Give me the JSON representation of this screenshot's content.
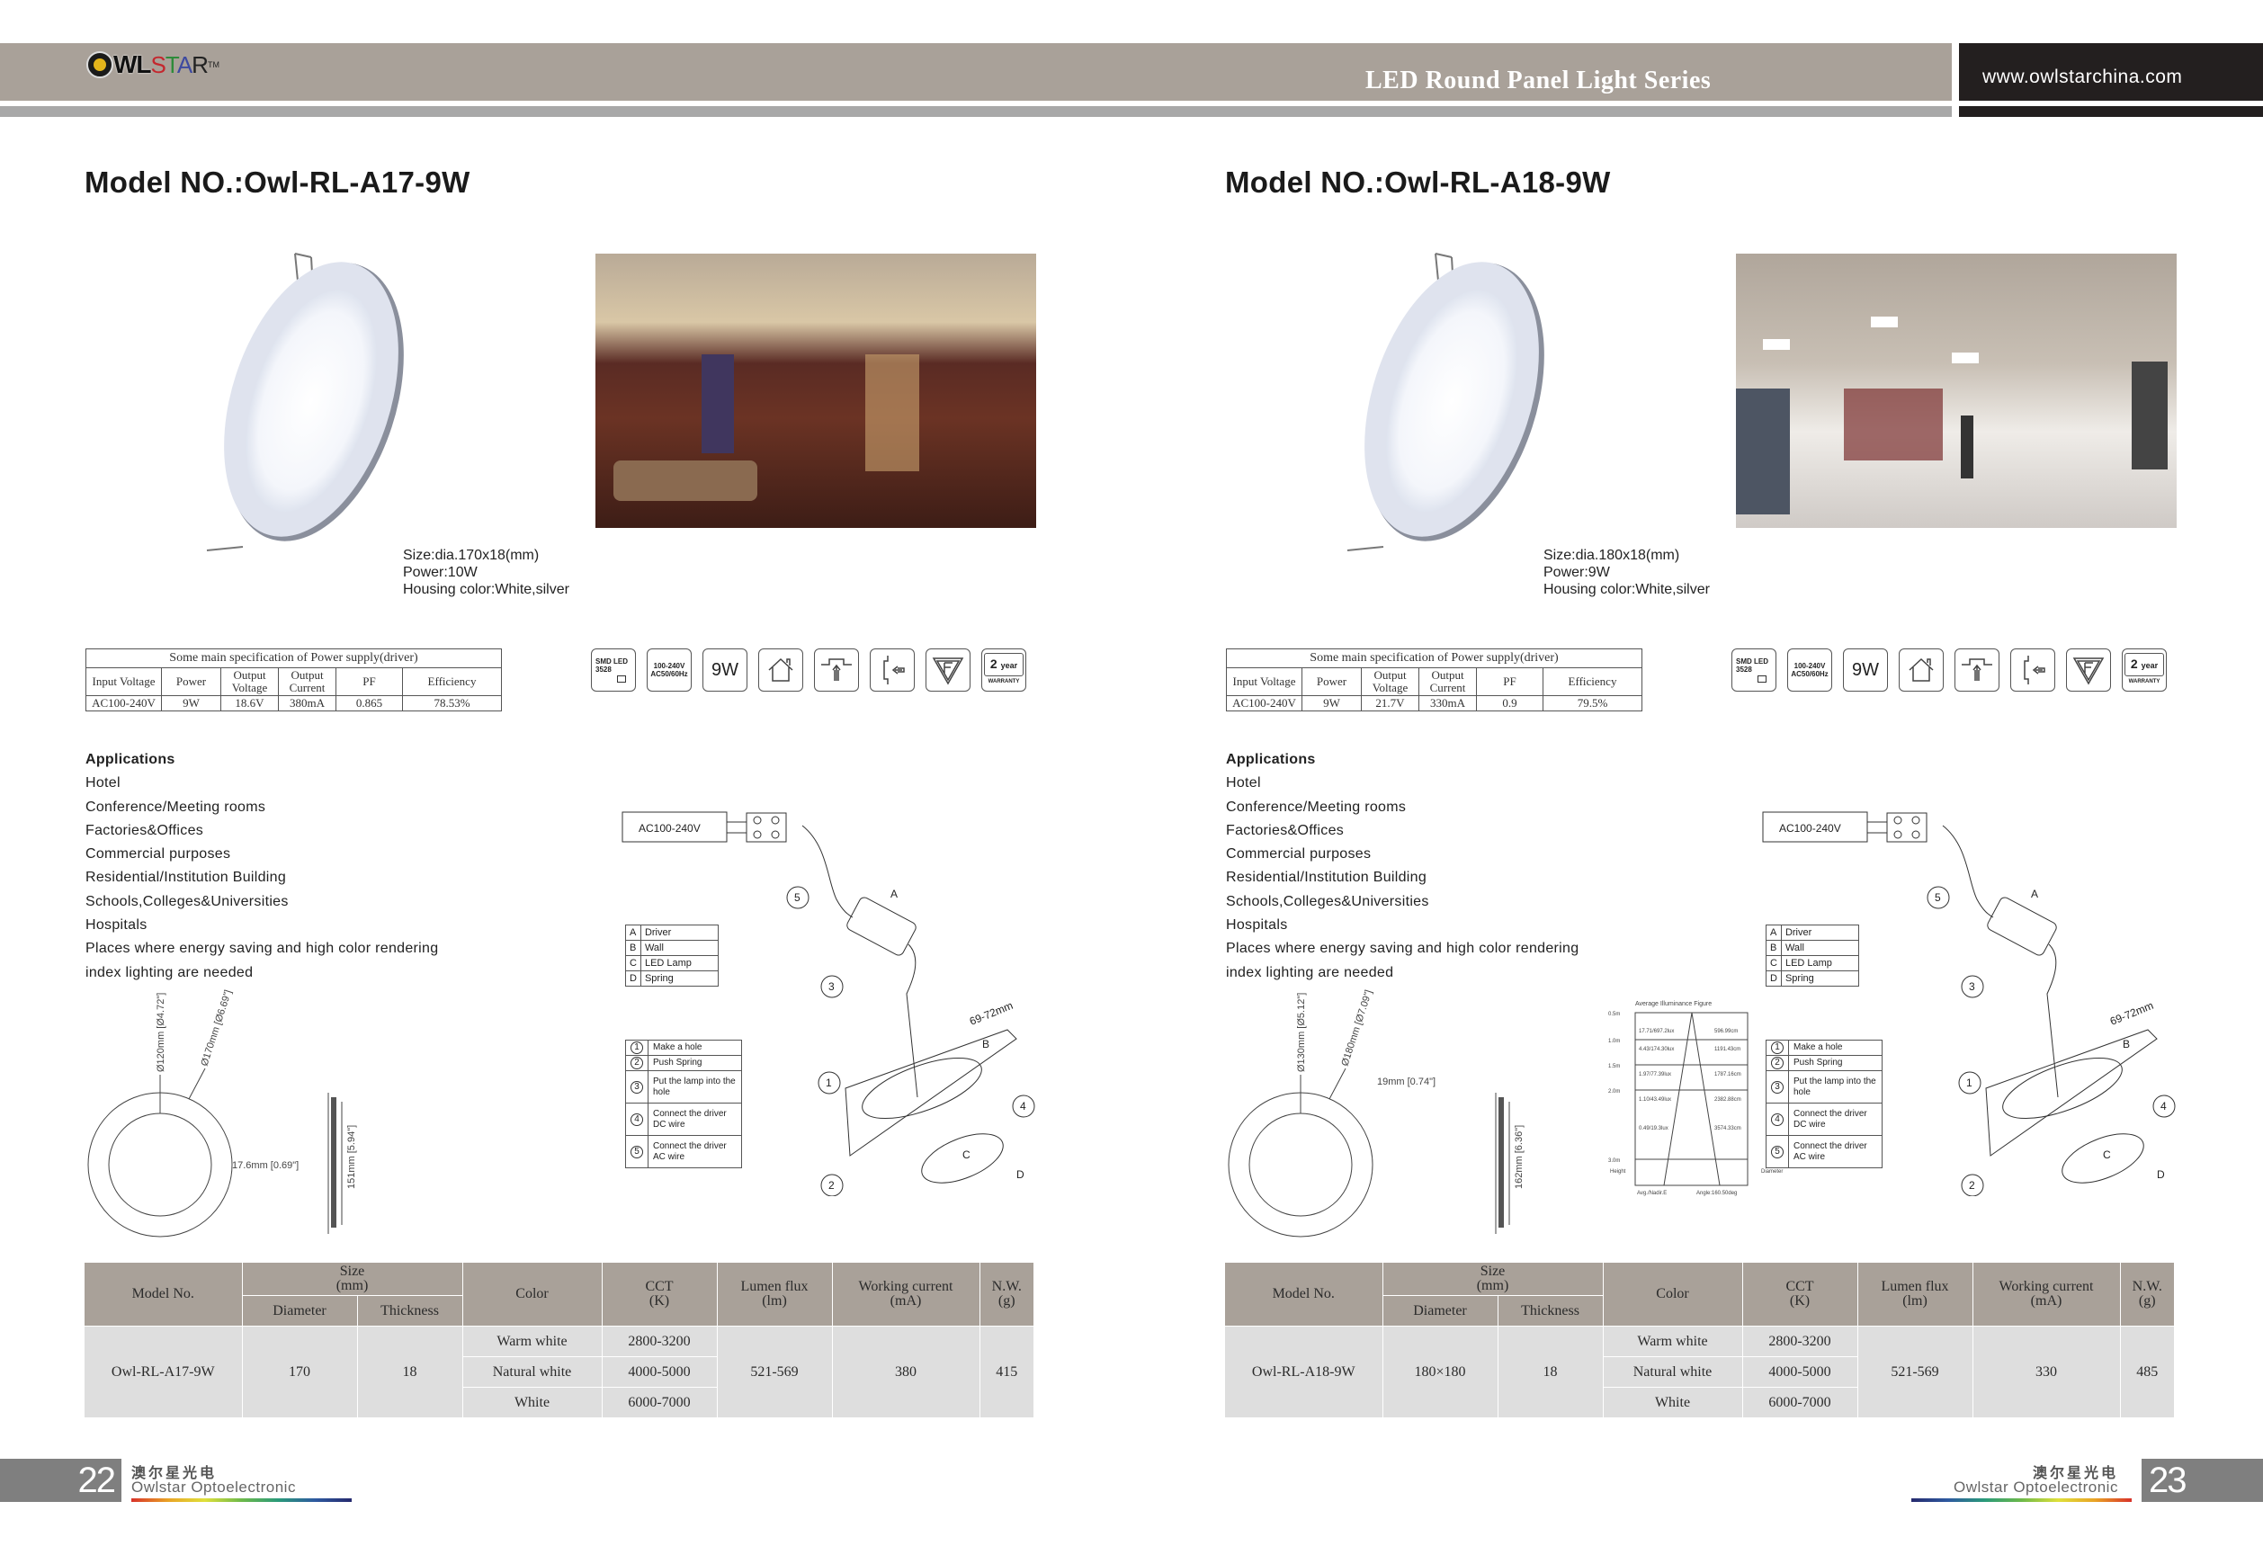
{
  "header": {
    "logo_text": "OWLSTAR",
    "logo_tm": "TM",
    "series_title": "LED Round Panel Light Series",
    "website": "www.owlstarchina.com"
  },
  "pages": [
    {
      "page_number": "22",
      "model_title": "Model NO.:Owl-RL-A17-9W",
      "spec_note": [
        "Size:dia.170x18(mm)",
        "Power:10W",
        "Housing color:White,silver"
      ],
      "photo_alt": "Living room interior with recessed lights",
      "driver_table": {
        "caption": "Some main specification of Power supply(driver)",
        "headers": [
          "Input Voltage",
          "Power",
          "Output Voltage",
          "Output Current",
          "PF",
          "Efficiency"
        ],
        "values": [
          "AC100-240V",
          "9W",
          "18.6V",
          "380mA",
          "0.865",
          "78.53%"
        ]
      },
      "badges": [
        {
          "icon": "smd-led-icon",
          "line1": "SMD LED",
          "line2": "3528"
        },
        {
          "icon": "voltage-icon",
          "line1": "100-240V",
          "line2": "AC50/60Hz"
        },
        {
          "icon": "power-icon",
          "line1": "9W"
        },
        {
          "icon": "indoor-house-icon"
        },
        {
          "icon": "recessed-mount-icon"
        },
        {
          "icon": "wall-insert-icon"
        },
        {
          "icon": "f-mark-icon"
        },
        {
          "icon": "warranty-icon",
          "line1": "2",
          "line1b": "year",
          "line2": "WARRANTY"
        }
      ],
      "applications": {
        "heading": "Applications",
        "items": [
          "Hotel",
          "Conference/Meeting rooms",
          "Factories&Offices",
          "Commercial purposes",
          "Residential/Institution Building",
          "Schools,Colleges&Universities",
          "Hospitals",
          "Places where energy saving and high color rendering",
          "index lighting are needed"
        ]
      },
      "dimensions": {
        "inner_dia": "Ø120mm [Ø4.72\"]",
        "outer_dia": "Ø170mm [Ø6.69\"]",
        "thickness": "17.6mm [0.69\"]",
        "cutout": "151mm [5.94\"]"
      },
      "product_table": {
        "headers": {
          "model": "Model No.",
          "size": "Size",
          "size_unit": "(mm)",
          "diameter": "Diameter",
          "thickness": "Thickness",
          "color": "Color",
          "cct": "CCT",
          "cct_unit": "(K)",
          "lumen": "Lumen flux",
          "lumen_unit": "(lm)",
          "current": "Working current",
          "current_unit": "(mA)",
          "nw": "N.W.",
          "nw_unit": "(g)"
        },
        "model": "Owl-RL-A17-9W",
        "diameter": "170",
        "thickness": "18",
        "colors": [
          {
            "name": "Warm white",
            "cct": "2800-3200"
          },
          {
            "name": "Natural white",
            "cct": "4000-5000"
          },
          {
            "name": "White",
            "cct": "6000-7000"
          }
        ],
        "lumen": "521-569",
        "current": "380",
        "nw": "415"
      }
    },
    {
      "page_number": "23",
      "model_title": "Model NO.:Owl-RL-A18-9W",
      "spec_note": [
        "Size:dia.180x18(mm)",
        "Power:9W",
        "Housing color:White,silver"
      ],
      "photo_alt": "Clothing showroom interior with panel lights",
      "driver_table": {
        "caption": "Some main specification of Power supply(driver)",
        "headers": [
          "Input Voltage",
          "Power",
          "Output Voltage",
          "Output Current",
          "PF",
          "Efficiency"
        ],
        "values": [
          "AC100-240V",
          "9W",
          "21.7V",
          "330mA",
          "0.9",
          "79.5%"
        ]
      },
      "badges": [
        {
          "icon": "smd-led-icon",
          "line1": "SMD LED",
          "line2": "3528"
        },
        {
          "icon": "voltage-icon",
          "line1": "100-240V",
          "line2": "AC50/60Hz"
        },
        {
          "icon": "power-icon",
          "line1": "9W"
        },
        {
          "icon": "indoor-house-icon"
        },
        {
          "icon": "recessed-mount-icon"
        },
        {
          "icon": "wall-insert-icon"
        },
        {
          "icon": "f-mark-icon"
        },
        {
          "icon": "warranty-icon",
          "line1": "2",
          "line1b": "year",
          "line2": "WARRANTY"
        }
      ],
      "applications": {
        "heading": "Applications",
        "items": [
          "Hotel",
          "Conference/Meeting rooms",
          "Factories&Offices",
          "Commercial purposes",
          "Residential/Institution Building",
          "Schools,Colleges&Universities",
          "Hospitals",
          "Places where energy saving and high color rendering",
          "index lighting are needed"
        ]
      },
      "dimensions": {
        "inner_dia": "Ø130mm [Ø5.12\"]",
        "outer_dia": "Ø180mm [Ø7.09\"]",
        "thickness": "19mm [0.74\"]",
        "cutout": "162mm [6.36\"]"
      },
      "illuminance": {
        "title": "Average Illuminance Figure",
        "heights": [
          "0.5m",
          "1.0m",
          "1.5m",
          "2.0m",
          "3.0m"
        ],
        "lux": [
          "17.71/697.2lux",
          "4.43/174.30lux",
          "1.97/77.39lux",
          "1.10/43.49lux",
          "0.49/19.3lux"
        ],
        "diameters": [
          "596.99cm",
          "1191.43cm",
          "1787.16cm",
          "2382.88cm",
          "3574.33cm"
        ],
        "height_label": "Height",
        "diameter_label": "Diameter",
        "avg_label": "Avg./Nadir.E",
        "angle_label": "Angle:160.50deg"
      },
      "product_table": {
        "headers": {
          "model": "Model No.",
          "size": "Size",
          "size_unit": "(mm)",
          "diameter": "Diameter",
          "thickness": "Thickness",
          "color": "Color",
          "cct": "CCT",
          "cct_unit": "(K)",
          "lumen": "Lumen flux",
          "lumen_unit": "(lm)",
          "current": "Working current",
          "current_unit": "(mA)",
          "nw": "N.W.",
          "nw_unit": "(g)"
        },
        "model": "Owl-RL-A18-9W",
        "diameter": "180×180",
        "thickness": "18",
        "colors": [
          {
            "name": "Warm white",
            "cct": "2800-3200"
          },
          {
            "name": "Natural white",
            "cct": "4000-5000"
          },
          {
            "name": "White",
            "cct": "6000-7000"
          }
        ],
        "lumen": "521-569",
        "current": "330",
        "nw": "485"
      }
    }
  ],
  "installation": {
    "supply_label": "AC100-240V",
    "dimension": "69-72mm",
    "parts": [
      {
        "key": "A",
        "label": "Driver"
      },
      {
        "key": "B",
        "label": "Wall"
      },
      {
        "key": "C",
        "label": "LED Lamp"
      },
      {
        "key": "D",
        "label": "Spring"
      }
    ],
    "steps": [
      {
        "n": "1",
        "label": "Make a hole"
      },
      {
        "n": "2",
        "label": "Push Spring"
      },
      {
        "n": "3",
        "label": "Put the lamp into the hole"
      },
      {
        "n": "4",
        "label": "Connect the driver DC wire"
      },
      {
        "n": "5",
        "label": "Connect the driver AC wire"
      }
    ]
  },
  "footer": {
    "company_cn": "澳尔星光电",
    "company_en": "Owlstar Optoelectronic"
  }
}
